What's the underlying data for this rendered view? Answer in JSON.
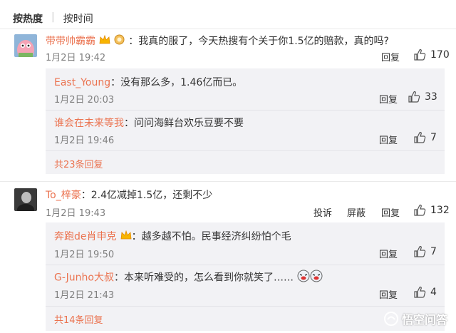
{
  "tabs": {
    "active": "按热度",
    "other": "按时间"
  },
  "comments": [
    {
      "name": "带带帅霸霸",
      "text": "：我真的服了，今天热搜有个关于你1.5亿的赔款，真的吗?",
      "time": "1月2日 19:42",
      "reply_label": "回复",
      "likes": "170",
      "replies": [
        {
          "name": "East_Young",
          "text": "：没有那么多，1.46亿而已。",
          "time": "1月2日 20:03",
          "reply_label": "回复",
          "likes": "33"
        },
        {
          "name": "谁会在未来等我",
          "text": "：问问海鲜台欢乐豆要不要",
          "time": "1月2日 19:46",
          "reply_label": "回复",
          "likes": "7"
        }
      ],
      "more": "共23条回复"
    },
    {
      "name": "To_梓豪",
      "text": "：2.4亿减掉1.5亿，还剩不少",
      "time": "1月2日 19:43",
      "report_label": "投诉",
      "block_label": "屏蔽",
      "reply_label": "回复",
      "likes": "132",
      "replies": [
        {
          "name": "奔跑de肖申克",
          "text": "：越多越不怕。民事经济纠纷怕个毛",
          "time": "1月2日 19:50",
          "reply_label": "回复",
          "likes": "7"
        },
        {
          "name": "G-Junho大叔",
          "text": "：本来听难受的，怎么看到你就笑了……",
          "time": "1月2日 21:43",
          "reply_label": "回复",
          "likes": "4"
        }
      ],
      "more": "共14条回复"
    }
  ],
  "watermark": "悟空问答",
  "colors": {
    "name": "#eb7350",
    "reply_bg": "#f2f2f5",
    "time": "#808080"
  }
}
